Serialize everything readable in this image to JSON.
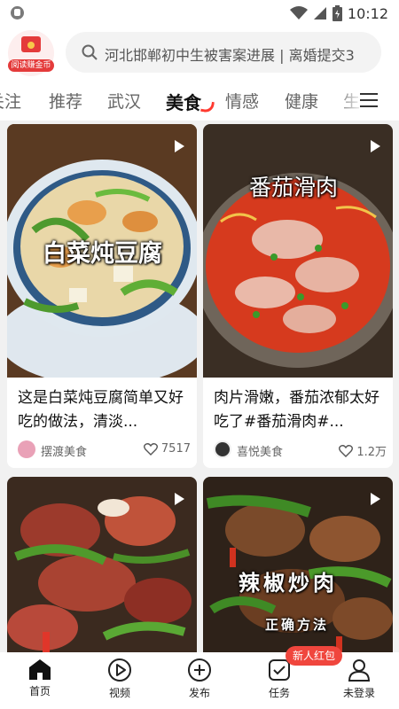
{
  "status_bar": {
    "time": "10:12"
  },
  "header": {
    "coin_label": "阅读赚金币",
    "search_placeholder": "河北邯郸初中生被害案进展 | 离婚提交3"
  },
  "tabs": [
    "关注",
    "推荐",
    "武汉",
    "美食",
    "情感",
    "健康",
    "生"
  ],
  "active_tab": "美食",
  "feed": [
    {
      "overlay_text": "白菜炖豆腐",
      "title": "这是白菜炖豆腐简单又好吃的做法，清淡...",
      "author": "摆渡美食",
      "likes": "7517",
      "is_video": true
    },
    {
      "overlay_text": "番茄滑肉",
      "title": "肉片滑嫩，番茄浓郁太好吃了#番茄滑肉#...",
      "author": "喜悦美食",
      "likes": "1.2万",
      "is_video": true
    },
    {
      "overlay_text": "",
      "title": "",
      "author": "",
      "likes": "",
      "is_video": true
    },
    {
      "overlay_text": "辣椒炒肉",
      "overlay_sub": "正确方法",
      "title": "",
      "author": "",
      "likes": "",
      "is_video": true
    }
  ],
  "bottom_nav": {
    "items": [
      {
        "label": "首页",
        "icon": "home-icon",
        "active": true
      },
      {
        "label": "视频",
        "icon": "video-play-icon",
        "active": false
      },
      {
        "label": "发布",
        "icon": "add-circle-icon",
        "active": false
      },
      {
        "label": "任务",
        "icon": "task-check-icon",
        "active": false
      },
      {
        "label": "未登录",
        "icon": "user-icon",
        "active": false
      }
    ],
    "badge": "新人红包"
  },
  "colors": {
    "accent": "#ff3a30",
    "badge": "#f0463d",
    "background": "#f1f1f1"
  }
}
